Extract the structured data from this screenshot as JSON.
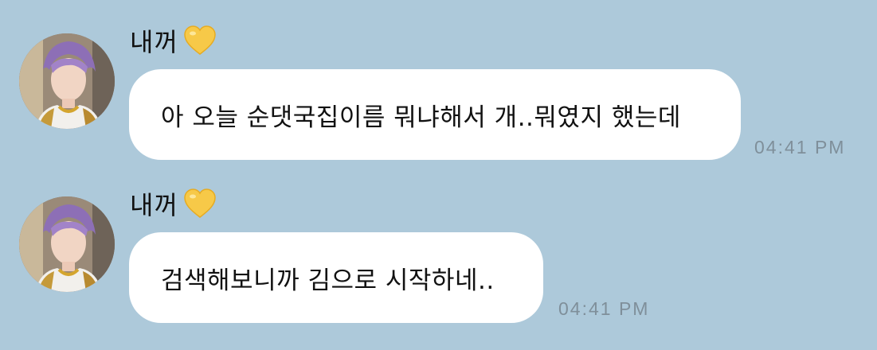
{
  "messages": [
    {
      "sender": "내꺼",
      "sender_icon": "yellow-heart-icon",
      "text": "아 오늘 순댓국집이름 뭐냐해서 개..뭐였지 했는데",
      "time": "04:41 PM"
    },
    {
      "sender": "내꺼",
      "sender_icon": "yellow-heart-icon",
      "text": "검색해보니까 김으로 시작하네..",
      "time": "04:41 PM"
    }
  ],
  "colors": {
    "background": "#adc9da",
    "bubble": "#ffffff",
    "timestamp": "#7f8f9a",
    "heart": "#f7c948"
  }
}
